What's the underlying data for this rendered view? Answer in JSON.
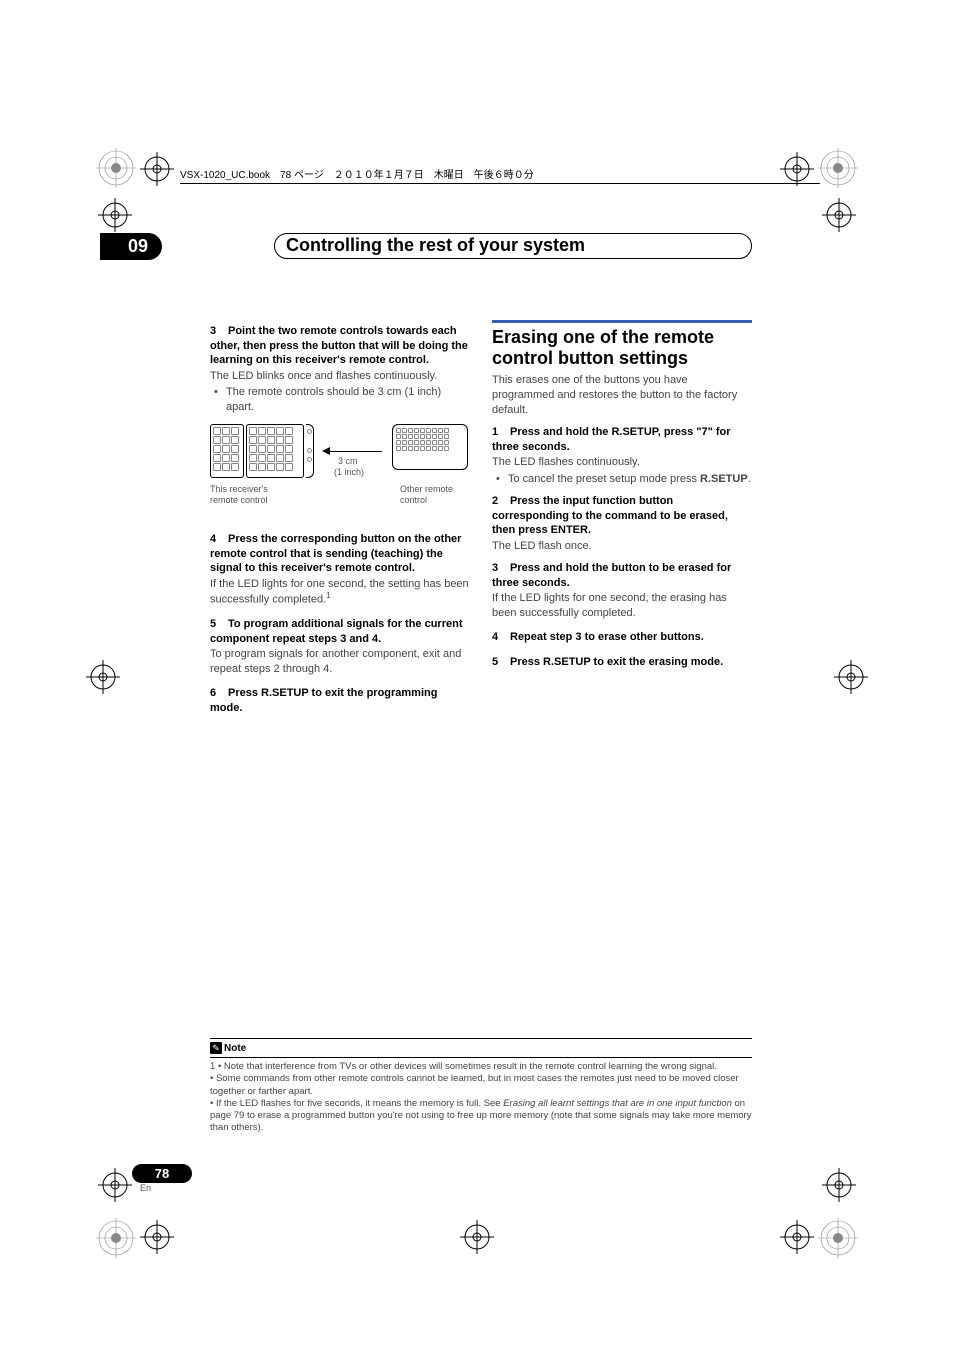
{
  "header_line": "VSX-1020_UC.book　78 ページ　２０１０年１月７日　木曜日　午後６時０分",
  "chapter": {
    "number": "09",
    "title": "Controlling the rest of your system"
  },
  "left": {
    "s3": {
      "num": "3",
      "head": "Point the two remote controls towards each other, then press the button that will be doing the learning on this receiver's remote control.",
      "body": "The LED blinks once and flashes continuously.",
      "bullet": "The remote controls should be 3 cm (1 inch) apart."
    },
    "diagram": {
      "dist1": "3 cm",
      "dist2": "(1 inch)",
      "left_label1": "This receiver's",
      "left_label2": "remote control",
      "right_label1": "Other remote",
      "right_label2": "control"
    },
    "s4": {
      "num": "4",
      "head": "Press the corresponding button on the other remote control that is sending (teaching) the signal to this receiver's remote control.",
      "body": "If the LED lights for one second, the setting has been successfully completed.",
      "sup": "1"
    },
    "s5": {
      "num": "5",
      "head": "To program additional signals for the current component repeat steps 3 and 4.",
      "body": "To program signals for another component, exit and repeat steps 2 through 4."
    },
    "s6": {
      "num": "6",
      "head": "Press R.SETUP to exit the programming mode."
    }
  },
  "right": {
    "title": "Erasing one of the remote control button settings",
    "intro": "This erases one of the buttons you have programmed and restores the button to the factory default.",
    "s1": {
      "num": "1",
      "head": "Press and hold the R.SETUP, press \"7\" for three seconds.",
      "body": "The LED flashes continuously.",
      "bullet_prefix": "To cancel the preset setup mode press ",
      "bullet_bold": "R.SETUP",
      "bullet_suffix": "."
    },
    "s2": {
      "num": "2",
      "head": "Press the input function button corresponding to the command to be erased, then press ENTER.",
      "body": "The LED flash once."
    },
    "s3": {
      "num": "3",
      "head": "Press and hold the button to be erased for three seconds.",
      "body": "If the LED lights for one second, the erasing has been successfully completed."
    },
    "s4": {
      "num": "4",
      "head": "Repeat step 3 to erase other buttons."
    },
    "s5": {
      "num": "5",
      "head": "Press R.SETUP to exit the erasing mode."
    }
  },
  "footnote": {
    "label": "Note",
    "lead": "1 ",
    "b1": "• Note that interference from TVs or other devices will sometimes result in the remote control learning the wrong signal.",
    "b2": "• Some commands from other remote controls cannot be learned, but in most cases the remotes just need to be moved closer together or farther apart.",
    "b3_a": "• If the LED flashes for five seconds, it means the memory is full. See ",
    "b3_i": "Erasing all learnt settings that are in one input function",
    "b3_b": " on page 79 to erase a programmed button you're not using to free up more memory (note that some signals may take more memory than others)."
  },
  "page": {
    "num": "78",
    "lang": "En"
  }
}
